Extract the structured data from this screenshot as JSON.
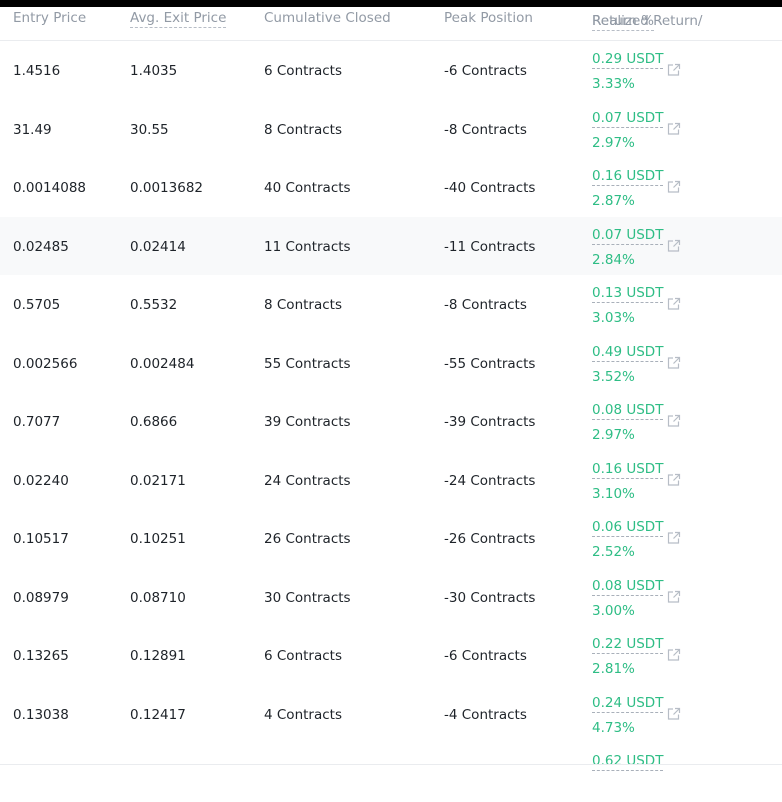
{
  "columns": {
    "entry_price": "Entry Price",
    "avg_exit_price": "Avg. Exit Price",
    "cumulative_closed": "Cumulative Closed",
    "peak_position": "Peak Position",
    "realized_return": "Realized Return/",
    "return_pct": "Return %"
  },
  "rows": [
    {
      "entry": "1.4516",
      "exit": "1.4035",
      "closed": "6 Contracts",
      "peak": "-6 Contracts",
      "pnl": "0.29 USDT",
      "pct": "3.33%"
    },
    {
      "entry": "31.49",
      "exit": "30.55",
      "closed": "8 Contracts",
      "peak": "-8 Contracts",
      "pnl": "0.07 USDT",
      "pct": "2.97%"
    },
    {
      "entry": "0.0014088",
      "exit": "0.0013682",
      "closed": "40 Contracts",
      "peak": "-40 Contracts",
      "pnl": "0.16 USDT",
      "pct": "2.87%"
    },
    {
      "entry": "0.02485",
      "exit": "0.02414",
      "closed": "11 Contracts",
      "peak": "-11 Contracts",
      "pnl": "0.07 USDT",
      "pct": "2.84%"
    },
    {
      "entry": "0.5705",
      "exit": "0.5532",
      "closed": "8 Contracts",
      "peak": "-8 Contracts",
      "pnl": "0.13 USDT",
      "pct": "3.03%"
    },
    {
      "entry": "0.002566",
      "exit": "0.002484",
      "closed": "55 Contracts",
      "peak": "-55 Contracts",
      "pnl": "0.49 USDT",
      "pct": "3.52%"
    },
    {
      "entry": "0.7077",
      "exit": "0.6866",
      "closed": "39 Contracts",
      "peak": "-39 Contracts",
      "pnl": "0.08 USDT",
      "pct": "2.97%"
    },
    {
      "entry": "0.02240",
      "exit": "0.02171",
      "closed": "24 Contracts",
      "peak": "-24 Contracts",
      "pnl": "0.16 USDT",
      "pct": "3.10%"
    },
    {
      "entry": "0.10517",
      "exit": "0.10251",
      "closed": "26 Contracts",
      "peak": "-26 Contracts",
      "pnl": "0.06 USDT",
      "pct": "2.52%"
    },
    {
      "entry": "0.08979",
      "exit": "0.08710",
      "closed": "30 Contracts",
      "peak": "-30 Contracts",
      "pnl": "0.08 USDT",
      "pct": "3.00%"
    },
    {
      "entry": "0.13265",
      "exit": "0.12891",
      "closed": "6 Contracts",
      "peak": "-6 Contracts",
      "pnl": "0.22 USDT",
      "pct": "2.81%"
    },
    {
      "entry": "0.13038",
      "exit": "0.12417",
      "closed": "4 Contracts",
      "peak": "-4 Contracts",
      "pnl": "0.24 USDT",
      "pct": "4.73%"
    },
    {
      "entry": "",
      "exit": "",
      "closed": "",
      "peak": "",
      "pnl": "0.62 USDT",
      "pct": ""
    }
  ],
  "highlighted_row": 3,
  "icons": {
    "share": "external-link-icon"
  },
  "colors": {
    "positive": "#2ebd85",
    "header_text": "#929aa5",
    "text": "#1e2329",
    "highlight": "#f8f9fa"
  }
}
